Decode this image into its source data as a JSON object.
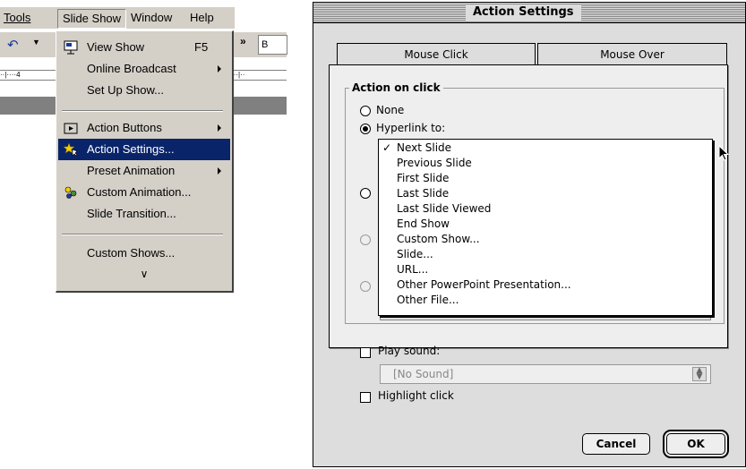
{
  "menubar": {
    "items": [
      "Tools",
      "Slide Show",
      "Window",
      "Help"
    ]
  },
  "toolbar": {
    "right_text": "B",
    "ruler_text_left": "··|····4",
    "ruler_text_right": "···|··"
  },
  "slide_menu": {
    "items": [
      {
        "label": "View Show",
        "accel": "F5",
        "icon": "view-show-icon"
      },
      {
        "label": "Online Broadcast",
        "submenu": true
      },
      {
        "label": "Set Up Show...",
        "submenu": false
      },
      {
        "label": "Action Buttons",
        "submenu": true,
        "icon": "action-buttons-icon"
      },
      {
        "label": "Action Settings...",
        "highlighted": true,
        "icon": "action-settings-icon"
      },
      {
        "label": "Preset Animation",
        "submenu": true
      },
      {
        "label": "Custom Animation...",
        "icon": "custom-animation-icon"
      },
      {
        "label": "Slide Transition..."
      },
      {
        "label": "Custom Shows..."
      }
    ],
    "more": "∨"
  },
  "dialog": {
    "title": "Action Settings",
    "tabs": [
      "Mouse Click",
      "Mouse Over"
    ],
    "group_title": "Action on click",
    "radio_none": "None",
    "radio_hyperlink": "Hyperlink to:",
    "hyperlink_options": [
      "Next Slide",
      "Previous Slide",
      "First Slide",
      "Last Slide",
      "Last Slide Viewed",
      "End Show",
      "Custom Show...",
      "Slide...",
      "URL...",
      "Other PowerPoint Presentation...",
      "Other File..."
    ],
    "selected_option": "Next Slide",
    "play_sound_label": "Play sound:",
    "sound_value": "[No Sound]",
    "highlight_label": "Highlight click",
    "cancel_label": "Cancel",
    "ok_label": "OK"
  }
}
